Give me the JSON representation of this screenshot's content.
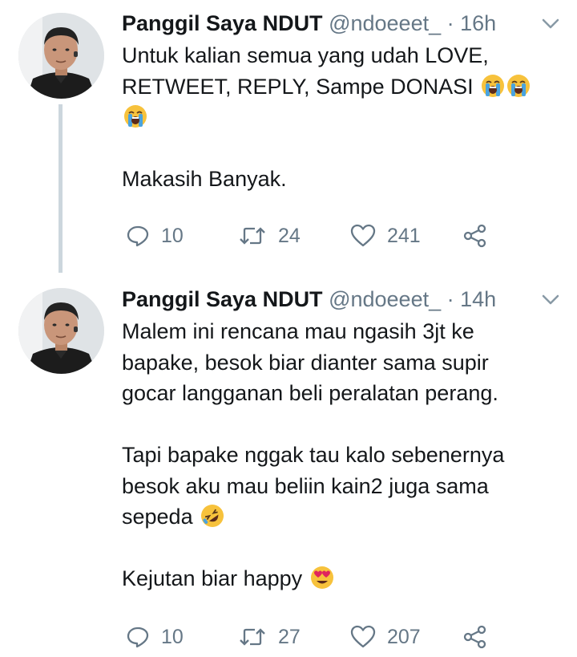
{
  "tweets": [
    {
      "name": "Panggil Saya NDUT",
      "handle": "@ndoeeet_",
      "separator": "·",
      "time": "16h",
      "lines": [
        "Untuk kalian semua yang udah LOVE,",
        "RETWEET, REPLY, Sampe DONASI",
        "",
        "",
        "Makasih Banyak."
      ],
      "emojis": [
        "loudly-crying-face",
        "loudly-crying-face",
        "loudly-crying-face"
      ],
      "replies": "10",
      "retweets": "24",
      "likes": "241"
    },
    {
      "name": "Panggil Saya NDUT",
      "handle": "@ndoeeet_",
      "separator": "·",
      "time": "14h",
      "lines": [
        "Malem ini rencana mau ngasih 3jt ke",
        "bapake, besok biar dianter sama supir",
        "gocar langganan beli peralatan perang.",
        "",
        "Tapi bapake nggak tau kalo sebenernya",
        "besok aku mau beliin kain2 juga sama",
        "sepeda",
        "",
        "Kejutan biar happy"
      ],
      "emojis": [
        "rolling-on-floor-laughing",
        "smiling-face-with-heart-eyes"
      ],
      "replies": "10",
      "retweets": "27",
      "likes": "207"
    }
  ],
  "colors": {
    "text": "#14171a",
    "secondary": "#657786",
    "thread_line": "#ccd6dd",
    "emoji": "#f7c23c"
  }
}
